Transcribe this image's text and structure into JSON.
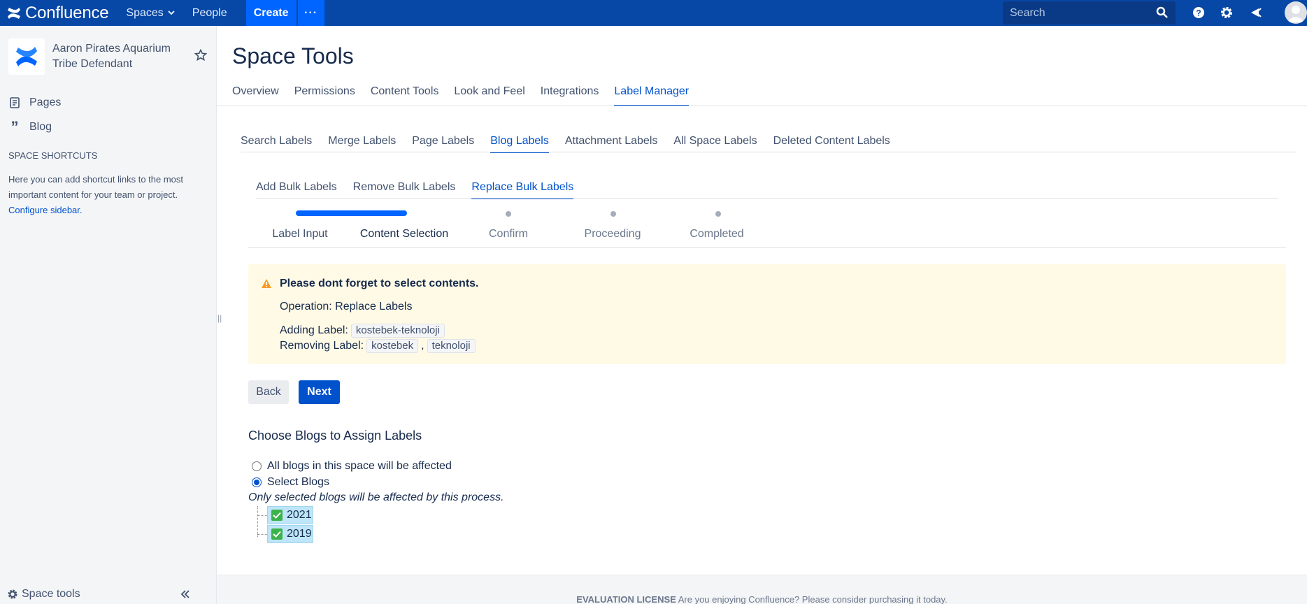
{
  "topbar": {
    "brand": "Confluence",
    "spaces": "Spaces",
    "people": "People",
    "create": "Create",
    "more": "···",
    "search_placeholder": "Search"
  },
  "sidebar": {
    "space_name": "Aaron Pirates Aquarium Tribe Defendant",
    "links": [
      {
        "label": "Pages",
        "icon": "pages-icon"
      },
      {
        "label": "Blog",
        "icon": "blog-quote-icon"
      }
    ],
    "shortcuts_title": "SPACE SHORTCUTS",
    "shortcuts_text": "Here you can add shortcut links to the most important content for your team or project.",
    "shortcuts_link": "Configure sidebar.",
    "space_tools": "Space tools"
  },
  "main": {
    "title": "Space Tools",
    "tabs": [
      "Overview",
      "Permissions",
      "Content Tools",
      "Look and Feel",
      "Integrations",
      "Label Manager"
    ],
    "active_tab": 5,
    "subtabs": [
      "Search Labels",
      "Merge Labels",
      "Page Labels",
      "Blog Labels",
      "Attachment Labels",
      "All Space Labels",
      "Deleted Content Labels"
    ],
    "active_subtab": 3,
    "bulktabs": [
      "Add Bulk Labels",
      "Remove Bulk Labels",
      "Replace Bulk Labels"
    ],
    "active_bulktab": 2,
    "steps": [
      "Label Input",
      "Content Selection",
      "Confirm",
      "Proceeding",
      "Completed"
    ],
    "current_step": 1,
    "warning": {
      "title": "Please dont forget to select contents.",
      "operation": "Operation: Replace Labels",
      "adding_label_text": "Adding Label:",
      "adding_labels": [
        "kostebek-teknoloji"
      ],
      "removing_label_text": "Removing Label:",
      "removing_labels": [
        "kostebek",
        "teknoloji"
      ]
    },
    "back": "Back",
    "next": "Next",
    "choose_title": "Choose Blogs to Assign Labels",
    "radio_all": "All blogs in this space will be affected",
    "radio_select": "Select Blogs",
    "selected_option": "select",
    "hint": "Only selected blogs will be affected by this process.",
    "tree": [
      "2021",
      "2019"
    ]
  },
  "footer": {
    "license_bold": "EVALUATION LICENSE",
    "license_text": "Are you enjoying Confluence? Please consider purchasing it today."
  },
  "colors": {
    "topbar": "#0747a6",
    "accent": "#0052cc",
    "warning_bg": "#fffae6",
    "progress": "#0065ff"
  }
}
